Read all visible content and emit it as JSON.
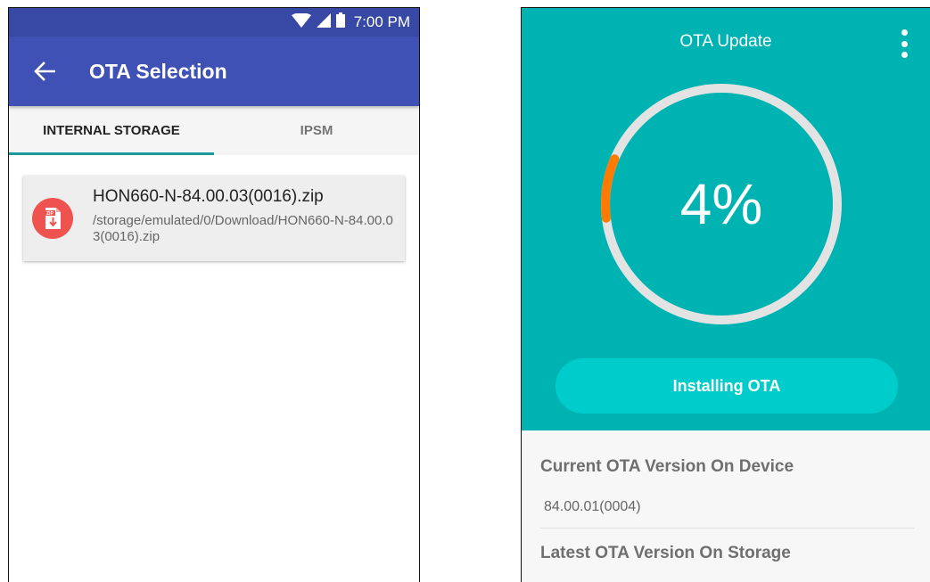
{
  "left_screen": {
    "status_bar": {
      "time": "7:00 PM",
      "icons": [
        "wifi-icon",
        "cell-signal-icon",
        "battery-icon"
      ]
    },
    "app_bar": {
      "back_icon": "arrow-left-icon",
      "title": "OTA Selection"
    },
    "tabs": [
      {
        "label": "INTERNAL STORAGE",
        "active": true
      },
      {
        "label": "IPSM",
        "active": false
      }
    ],
    "files": [
      {
        "icon": "zip-file-icon",
        "icon_badge": "ZIP",
        "name": "HON660-N-84.00.03(0016).zip",
        "path": "/storage/emulated/0/Download/HON660-N-84.00.03(0016).zip"
      }
    ]
  },
  "right_screen": {
    "title": "OTA Update",
    "menu_icon": "more-vert-icon",
    "progress": {
      "value": 4,
      "label": "4%"
    },
    "install_button": "Installing OTA",
    "current_version": {
      "label": "Current OTA Version On Device",
      "value": "84.00.01(0004)"
    },
    "latest_version": {
      "label": "Latest OTA Version On Storage"
    }
  },
  "colors": {
    "indigo_primary": "#3f51b5",
    "indigo_dark": "#3849a5",
    "teal": "#00b3b3",
    "teal_button": "#00cccc",
    "tab_indicator": "#1a9a99",
    "progress_orange": "#ff7a00",
    "zip_red": "#ef5350"
  }
}
